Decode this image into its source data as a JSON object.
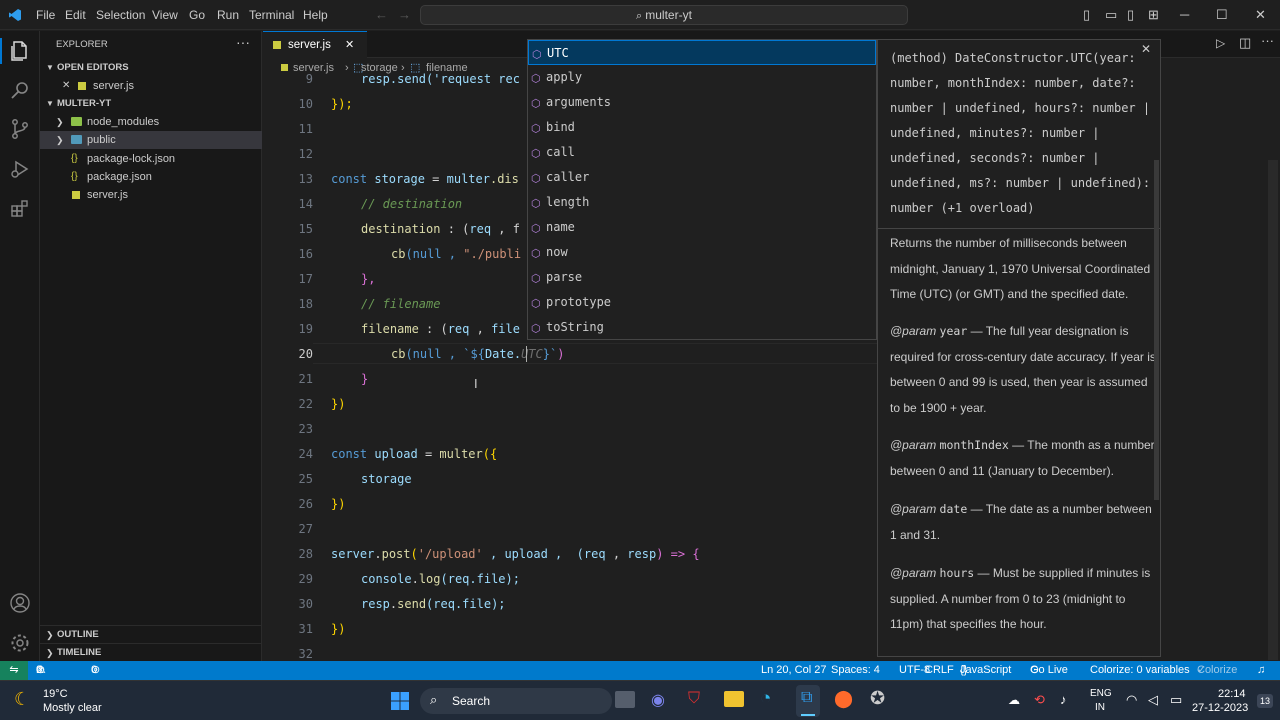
{
  "menu": [
    "File",
    "Edit",
    "Selection",
    "View",
    "Go",
    "Run",
    "Terminal",
    "Help"
  ],
  "search_title": "multer-yt",
  "sidebar": {
    "title": "EXPLORER",
    "open_editors": "OPEN EDITORS",
    "open_file": "server.js",
    "project": "MULTER-YT",
    "tree": [
      "node_modules",
      "public",
      "package-lock.json",
      "package.json",
      "server.js"
    ],
    "outline": "OUTLINE",
    "timeline": "TIMELINE"
  },
  "tab": {
    "label": "server.js"
  },
  "breadcrumb": {
    "file": "server.js",
    "p1": "storage",
    "p2": "filename"
  },
  "gutter": [
    "9",
    "10",
    "11",
    "12",
    "13",
    "14",
    "15",
    "16",
    "17",
    "18",
    "19",
    "20",
    "21",
    "22",
    "23",
    "24",
    "25",
    "26",
    "27",
    "28",
    "29",
    "30",
    "31",
    "32"
  ],
  "code": {
    "l9": "resp.send('request rec",
    "l10": "});",
    "l13a": "const ",
    "l13b": "storage",
    "l13c": " = ",
    "l13d": "multer",
    "l13e": ".dis",
    "l14": "// destination",
    "l15a": "destination",
    "l15b": " : (",
    "l15c": "req",
    "l15d": " , f",
    "l16a": "cb",
    "l16b": "(null , ",
    "l16c": "\"./publi",
    "l17": "},",
    "l18": "// filename",
    "l19a": "filename",
    "l19b": " : (",
    "l19c": "req",
    "l19d": " , ",
    "l19e": "file",
    "l20a": "cb",
    "l20b": "(null , ",
    "l20c": "`${",
    "l20d": "Date.",
    "l20e": "UTC",
    "l20f": "}`",
    "l20g": ")",
    "l21": "}",
    "l22": "})",
    "l24a": "const ",
    "l24b": "upload",
    "l24c": " = ",
    "l24d": "multer",
    "l24e": "({",
    "l25": "storage",
    "l26": "})",
    "l28a": "server",
    "l28b": ".",
    "l28c": "post",
    "l28d": "(",
    "l28e": "'/upload'",
    "l28f": " , upload ,  (",
    "l28g": "req",
    "l28h": " , ",
    "l28i": "resp",
    "l28j": ") => {",
    "l29a": "console",
    "l29b": ".",
    "l29c": "log",
    "l29d": "(req.file);",
    "l30a": "resp",
    "l30b": ".",
    "l30c": "send",
    "l30d": "(req.file);",
    "l31": "})"
  },
  "suggestions": [
    "UTC",
    "apply",
    "arguments",
    "bind",
    "call",
    "caller",
    "length",
    "name",
    "now",
    "parse",
    "prototype",
    "toString"
  ],
  "docs": {
    "signature": "(method) DateConstructor.UTC(year: number, monthIndex: number, date?: number | undefined, hours?: number | undefined, minutes?: number | undefined, seconds?: number | undefined, ms?: number | undefined): number (+1 overload)",
    "desc": "Returns the number of milliseconds between midnight, January 1, 1970 Universal Coordinated Time (UTC) (or GMT) and the specified date.",
    "params": [
      {
        "tag": "@param",
        "name": "year",
        "text": "— The full year designation is required for cross-century date accuracy. If year is between 0 and 99 is used, then year is assumed to be 1900 + year."
      },
      {
        "tag": "@param",
        "name": "monthIndex",
        "text": "— The month as a number between 0 and 11 (January to December)."
      },
      {
        "tag": "@param",
        "name": "date",
        "text": "— The date as a number between 1 and 31."
      },
      {
        "tag": "@param",
        "name": "hours",
        "text": "— Must be supplied if minutes is supplied. A number from 0 to 23 (midnight to 11pm) that specifies the hour."
      }
    ]
  },
  "status": {
    "errors": "0",
    "warnings": "0",
    "ports": "0",
    "position": "Ln 20, Col 27",
    "spaces": "Spaces: 4",
    "encoding": "UTF-8",
    "eol": "CRLF",
    "language": "JavaScript",
    "golive": "Go Live",
    "colorize": "Colorize: 0 variables",
    "colorize2": "Colorize"
  },
  "taskbar": {
    "temp": "19°C",
    "weather": "Mostly clear",
    "search": "Search",
    "lang1": "ENG",
    "lang2": "IN",
    "time": "22:14",
    "date": "27-12-2023",
    "badge": "13"
  },
  "colors": {
    "accent": "#007acc",
    "bg": "#1f1f1f",
    "keyword": "#569cd6",
    "string": "#ce9178",
    "function": "#dcdcaa",
    "variable": "#9cdcfe"
  }
}
